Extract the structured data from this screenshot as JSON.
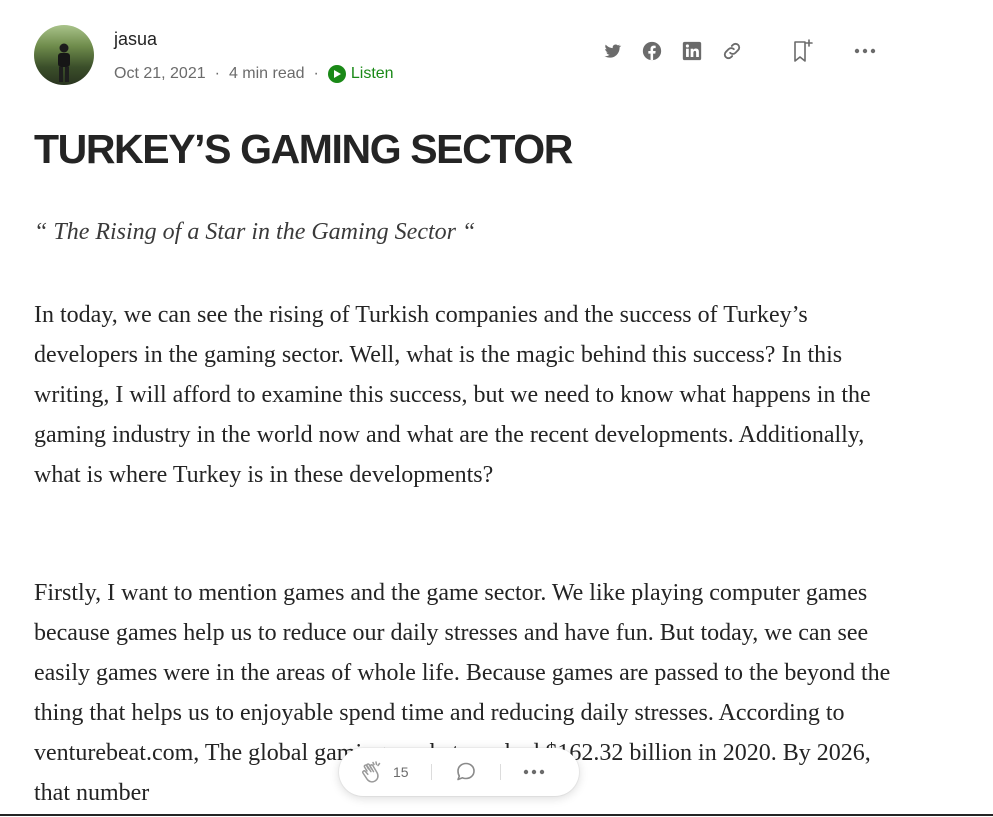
{
  "author": {
    "name": "jasua",
    "date": "Oct 21, 2021",
    "read_time": "4 min read",
    "separator": "·",
    "listen_label": "Listen"
  },
  "share_icons": [
    "twitter-icon",
    "facebook-icon",
    "linkedin-icon",
    "link-icon",
    "bookmark-add-icon",
    "more-icon"
  ],
  "article": {
    "title": "TURKEY’S GAMING SECTOR",
    "subtitle": "“ The Rising of a Star in the Gaming Sector “",
    "paragraphs": [
      "In today, we can see the rising of Turkish companies and the success of Turkey’s developers in the gaming sector. Well, what is the magic behind this success? In this writing, I will afford to examine this success, but we need to know what happens in the gaming industry in the world now and what are the recent developments. Additionally, what is where Turkey is in these developments?",
      "Firstly, I want to mention games and the game sector. We like playing computer games because games help us to reduce our daily stresses and have fun. But today, we can see easily games were in the areas of whole life. Because games are passed to the beyond the thing that helps us to enjoyable spend time and reducing daily stresses. According to venturebeat.com, The global gaming market reached $162.32 billion in 2020. By 2026, that number"
    ]
  },
  "engagement": {
    "clap_count": "15"
  },
  "colors": {
    "accent_green": "#1a8917",
    "text": "#242424",
    "muted": "#6b6b6b"
  }
}
